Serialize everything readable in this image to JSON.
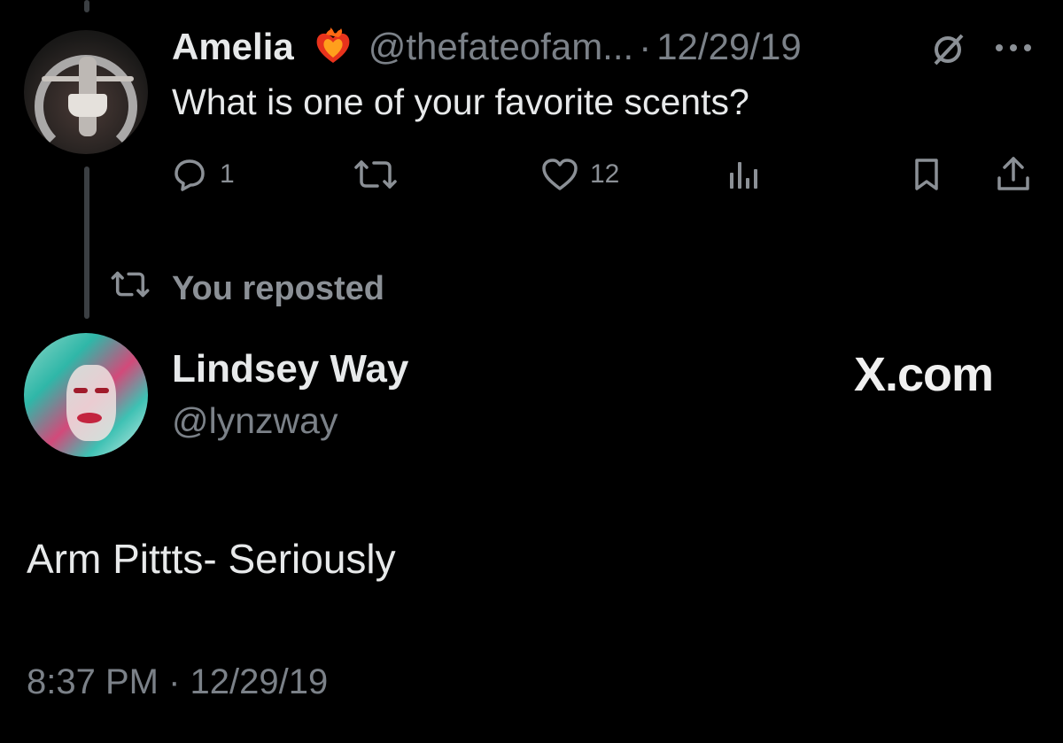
{
  "parent_tweet": {
    "author_name": "Amelia",
    "author_handle": "@thefateofam...",
    "separator": "·",
    "date": "12/29/19",
    "text": "What is one of your favorite scents?",
    "reply_count": "1",
    "like_count": "12",
    "badge_emoji": "burning-heart-emoji"
  },
  "repost_label": "You reposted",
  "quoted_tweet": {
    "author_name": "Lindsey Way",
    "author_handle": "@lynzway",
    "watermark": "X.com",
    "text": "Arm Pittts- Seriously",
    "timestamp": "8:37 PM · 12/29/19"
  },
  "icons": {
    "badge": "burning-heart-emoji",
    "edited": "edited-slash-icon",
    "more": "more-icon",
    "reply": "reply-icon",
    "repost": "repost-icon",
    "like": "heart-icon",
    "views": "views-icon",
    "bookmark": "bookmark-icon",
    "share": "share-icon",
    "reposted": "repost-icon"
  },
  "colors": {
    "background": "#000000",
    "text": "#e7e9ea",
    "muted": "#7b8188",
    "thread_line": "#3b3f43"
  }
}
